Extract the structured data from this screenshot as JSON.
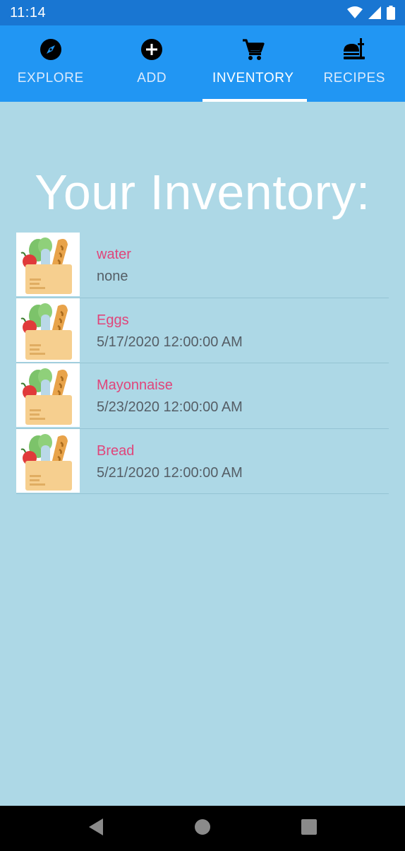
{
  "status_bar": {
    "time": "11:14"
  },
  "tabs": [
    {
      "label": "EXPLORE",
      "icon": "compass-icon",
      "active": false
    },
    {
      "label": "ADD",
      "icon": "add-circle-icon",
      "active": false
    },
    {
      "label": "INVENTORY",
      "icon": "cart-icon",
      "active": true
    },
    {
      "label": "RECIPES",
      "icon": "food-icon",
      "active": false
    }
  ],
  "page": {
    "title": "Your Inventory:"
  },
  "inventory": [
    {
      "name": "water",
      "date": "none"
    },
    {
      "name": "Eggs",
      "date": "5/17/2020 12:00:00 AM"
    },
    {
      "name": "Mayonnaise",
      "date": "5/23/2020 12:00:00 AM"
    },
    {
      "name": "Bread",
      "date": "5/21/2020 12:00:00 AM"
    }
  ],
  "colors": {
    "status_bar": "#1976d2",
    "tab_bar": "#2196f3",
    "background": "#add8e6",
    "item_name": "#e0457a",
    "item_date": "#555e66"
  },
  "nav_bar": {
    "buttons": [
      "back-icon",
      "home-icon",
      "recents-icon"
    ]
  }
}
